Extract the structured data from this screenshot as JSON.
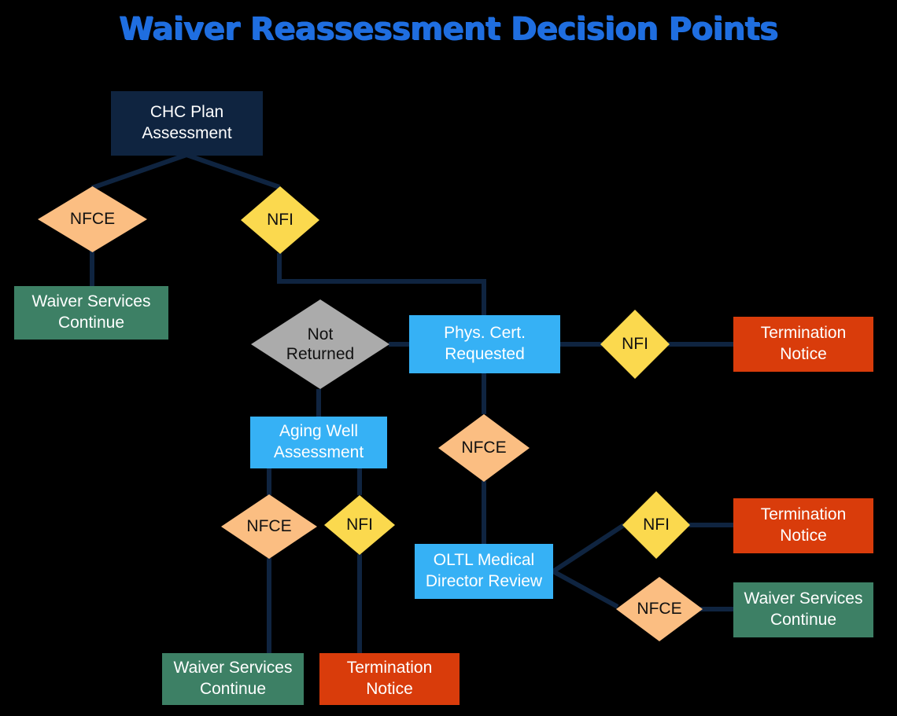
{
  "title": "Waiver Reassessment Decision Points",
  "colors": {
    "background": "#000000",
    "title": "#1f6ee0",
    "process_navy": "#0f2440",
    "process_blue": "#36b1f5",
    "outcome_green": "#3d8065",
    "outcome_red": "#d93c0b",
    "decision_peach": "#fbbe82",
    "decision_yellow": "#fbd94e",
    "decision_gray": "#ababab",
    "connector": "#0f2440"
  },
  "nodes": {
    "chc_plan_assessment": {
      "label": "CHC Plan\nAssessment",
      "line1": "CHC Plan",
      "line2": "Assessment",
      "shape": "box",
      "color": "navy"
    },
    "decision_nfce_top": {
      "label": "NFCE",
      "shape": "diamond",
      "color": "peach"
    },
    "decision_nfi_top": {
      "label": "NFI",
      "shape": "diamond",
      "color": "yellow"
    },
    "waiver_services_continue_left": {
      "line1": "Waiver Services",
      "line2": "Continue",
      "shape": "box",
      "color": "green"
    },
    "not_returned": {
      "line1": "Not",
      "line2": "Returned",
      "shape": "diamond",
      "color": "gray"
    },
    "phys_cert_requested": {
      "line1": "Phys. Cert.",
      "line2": "Requested",
      "shape": "box",
      "color": "blue"
    },
    "decision_nfi_phys": {
      "label": "NFI",
      "shape": "diamond",
      "color": "yellow"
    },
    "termination_notice_top_right": {
      "line1": "Termination",
      "line2": "Notice",
      "shape": "box",
      "color": "red"
    },
    "aging_well_assessment": {
      "line1": "Aging Well",
      "line2": "Assessment",
      "shape": "box",
      "color": "blue"
    },
    "decision_nfce_phys": {
      "label": "NFCE",
      "shape": "diamond",
      "color": "peach"
    },
    "decision_nfce_aging": {
      "label": "NFCE",
      "shape": "diamond",
      "color": "peach"
    },
    "decision_nfi_aging": {
      "label": "NFI",
      "shape": "diamond",
      "color": "yellow"
    },
    "oltl_medical_director_review": {
      "line1": "OLTL Medical",
      "line2": "Director Review",
      "shape": "box",
      "color": "blue"
    },
    "decision_nfi_oltl": {
      "label": "NFI",
      "shape": "diamond",
      "color": "yellow"
    },
    "termination_notice_mid_right": {
      "line1": "Termination",
      "line2": "Notice",
      "shape": "box",
      "color": "red"
    },
    "decision_nfce_oltl": {
      "label": "NFCE",
      "shape": "diamond",
      "color": "peach"
    },
    "waiver_services_continue_right": {
      "line1": "Waiver Services",
      "line2": "Continue",
      "shape": "box",
      "color": "green"
    },
    "waiver_services_continue_bottom": {
      "line1": "Waiver Services",
      "line2": "Continue",
      "shape": "box",
      "color": "green"
    },
    "termination_notice_bottom": {
      "line1": "Termination",
      "line2": "Notice",
      "shape": "box",
      "color": "red"
    }
  }
}
